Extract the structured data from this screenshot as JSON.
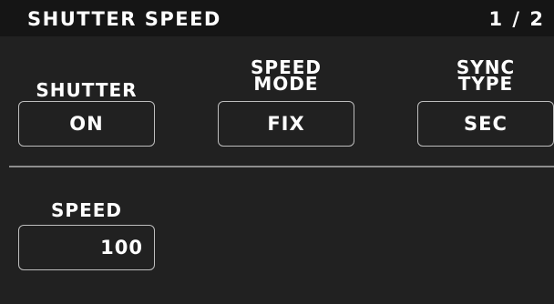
{
  "header": {
    "title": "SHUTTER SPEED",
    "page": "1 / 2"
  },
  "settings": [
    {
      "label_line1": "",
      "label_line2": "SHUTTER",
      "value": "ON"
    },
    {
      "label_line1": "SPEED",
      "label_line2": "MODE",
      "value": "FIX"
    },
    {
      "label_line1": "SYNC",
      "label_line2": "TYPE",
      "value": "SEC"
    }
  ],
  "speed": {
    "label": "SPEED",
    "value": "100"
  },
  "colors": {
    "background": "#212121",
    "header_background": "#151515",
    "text": "#ffffff",
    "box_border": "#bdbdbd",
    "divider": "#8e8e8e"
  }
}
